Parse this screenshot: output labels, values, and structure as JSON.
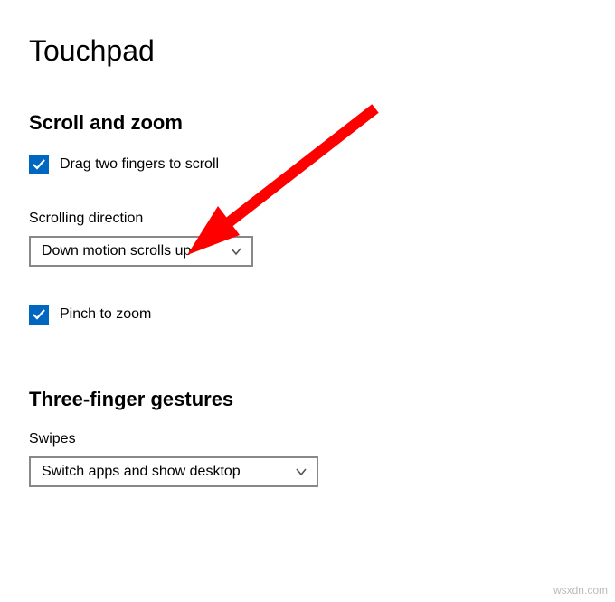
{
  "page": {
    "title": "Touchpad"
  },
  "sections": {
    "scroll_zoom": {
      "title": "Scroll and zoom",
      "drag_two_fingers": {
        "label": "Drag two fingers to scroll",
        "checked": true
      },
      "scrolling_direction": {
        "label": "Scrolling direction",
        "value": "Down motion scrolls up"
      },
      "pinch_zoom": {
        "label": "Pinch to zoom",
        "checked": true
      }
    },
    "three_finger": {
      "title": "Three-finger gestures",
      "swipes": {
        "label": "Swipes",
        "value": "Switch apps and show desktop"
      }
    }
  },
  "watermark": "wsxdn.com",
  "colors": {
    "accent": "#0067c0",
    "arrow": "#ff0000"
  }
}
